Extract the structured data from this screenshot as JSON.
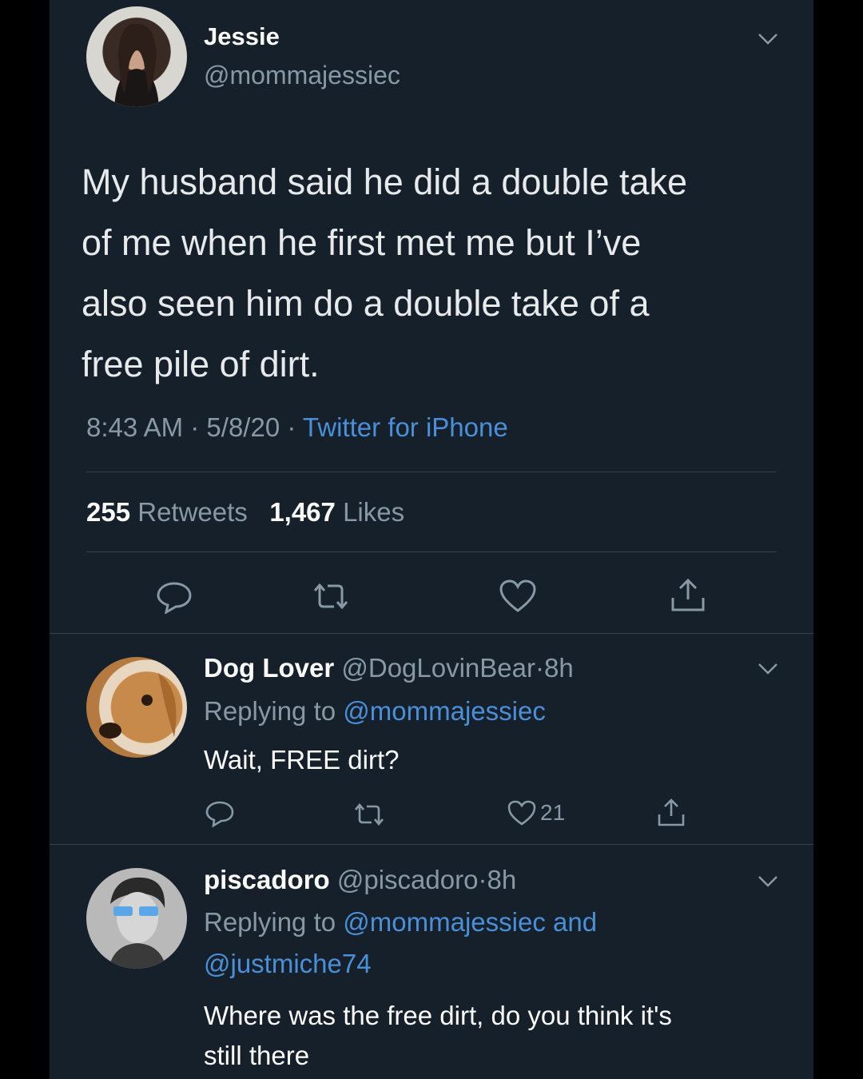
{
  "main_tweet": {
    "display_name": "Jessie",
    "handle": "@mommajessiec",
    "text_lines": [
      "My husband said he did a double take",
      "of me when he first met me but I’ve",
      "also seen him do a double take of a",
      "free pile of dirt."
    ],
    "time": "8:43 AM",
    "date": "5/8/20",
    "source": "Twitter for iPhone",
    "retweets_count": "255",
    "retweets_label": "Retweets",
    "likes_count": "1,467",
    "likes_label": "Likes",
    "sep": "·"
  },
  "replies": [
    {
      "display_name": "Dog Lover",
      "handle": "@DogLovinBear",
      "age": "8h",
      "replying_prefix": "Replying to",
      "replying_to": "@mommajessiec",
      "text": "Wait, FREE dirt?",
      "like_count": "21"
    },
    {
      "display_name": "piscadoro",
      "handle": "@piscadoro",
      "age": "8h",
      "replying_prefix": "Replying to",
      "replying_to": "@mommajessiec and",
      "replying_to_2": "@justmiche74",
      "text_lines": [
        "Where was the free dirt, do you think it's",
        "still there"
      ]
    }
  ],
  "colors": {
    "background": "#15202b",
    "text": "#e7e9ea",
    "muted": "#8899a6",
    "link": "#4a90d9",
    "divider": "#38444d"
  },
  "icons": {
    "reply": "speech-bubble-icon",
    "retweet": "retweet-arrows-icon",
    "like": "heart-icon",
    "share": "share-upload-icon",
    "more": "chevron-down-icon"
  }
}
